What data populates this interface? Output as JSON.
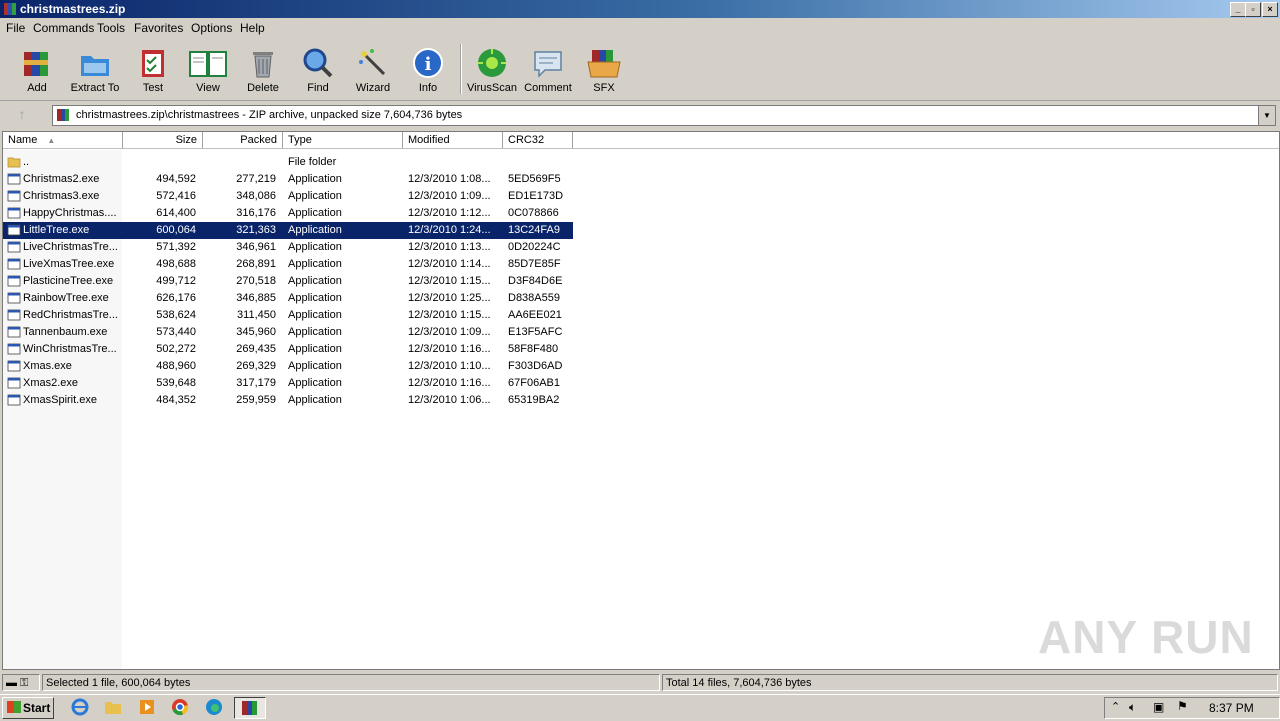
{
  "window": {
    "title": "christmastrees.zip"
  },
  "menu": [
    "File",
    "Commands",
    "Tools",
    "Favorites",
    "Options",
    "Help"
  ],
  "toolbar": [
    "Add",
    "Extract To",
    "Test",
    "View",
    "Delete",
    "Find",
    "Wizard",
    "Info",
    "VirusScan",
    "Comment",
    "SFX"
  ],
  "address": {
    "path": "christmastrees.zip\\christmastrees - ZIP archive, unpacked size 7,604,736 bytes"
  },
  "columns": [
    "Name",
    "Size",
    "Packed",
    "Type",
    "Modified",
    "CRC32"
  ],
  "files": [
    {
      "name": "..",
      "size": "",
      "packed": "",
      "type": "File folder",
      "modified": "",
      "crc": ""
    },
    {
      "name": "Christmas2.exe",
      "size": "494,592",
      "packed": "277,219",
      "type": "Application",
      "modified": "12/3/2010 1:08...",
      "crc": "5ED569F5"
    },
    {
      "name": "Christmas3.exe",
      "size": "572,416",
      "packed": "348,086",
      "type": "Application",
      "modified": "12/3/2010 1:09...",
      "crc": "ED1E173D"
    },
    {
      "name": "HappyChristmas....",
      "size": "614,400",
      "packed": "316,176",
      "type": "Application",
      "modified": "12/3/2010 1:12...",
      "crc": "0C078866"
    },
    {
      "name": "LittleTree.exe",
      "size": "600,064",
      "packed": "321,363",
      "type": "Application",
      "modified": "12/3/2010 1:24...",
      "crc": "13C24FA9"
    },
    {
      "name": "LiveChristmasTre...",
      "size": "571,392",
      "packed": "346,961",
      "type": "Application",
      "modified": "12/3/2010 1:13...",
      "crc": "0D20224C"
    },
    {
      "name": "LiveXmasTree.exe",
      "size": "498,688",
      "packed": "268,891",
      "type": "Application",
      "modified": "12/3/2010 1:14...",
      "crc": "85D7E85F"
    },
    {
      "name": "PlasticineTree.exe",
      "size": "499,712",
      "packed": "270,518",
      "type": "Application",
      "modified": "12/3/2010 1:15...",
      "crc": "D3F84D6E"
    },
    {
      "name": "RainbowTree.exe",
      "size": "626,176",
      "packed": "346,885",
      "type": "Application",
      "modified": "12/3/2010 1:25...",
      "crc": "D838A559"
    },
    {
      "name": "RedChristmasTre...",
      "size": "538,624",
      "packed": "311,450",
      "type": "Application",
      "modified": "12/3/2010 1:15...",
      "crc": "AA6EE021"
    },
    {
      "name": "Tannenbaum.exe",
      "size": "573,440",
      "packed": "345,960",
      "type": "Application",
      "modified": "12/3/2010 1:09...",
      "crc": "E13F5AFC"
    },
    {
      "name": "WinChristmasTre...",
      "size": "502,272",
      "packed": "269,435",
      "type": "Application",
      "modified": "12/3/2010 1:16...",
      "crc": "58F8F480"
    },
    {
      "name": "Xmas.exe",
      "size": "488,960",
      "packed": "269,329",
      "type": "Application",
      "modified": "12/3/2010 1:10...",
      "crc": "F303D6AD"
    },
    {
      "name": "Xmas2.exe",
      "size": "539,648",
      "packed": "317,179",
      "type": "Application",
      "modified": "12/3/2010 1:16...",
      "crc": "67F06AB1"
    },
    {
      "name": "XmasSpirit.exe",
      "size": "484,352",
      "packed": "259,959",
      "type": "Application",
      "modified": "12/3/2010 1:06...",
      "crc": "65319BA2"
    }
  ],
  "selected_index": 4,
  "status": {
    "left": "Selected 1 file, 600,064 bytes",
    "right": "Total 14 files, 7,604,736 bytes"
  },
  "taskbar": {
    "start": "Start",
    "clock": "8:37 PM"
  },
  "watermark": "ANY RUN",
  "colors": {
    "selection": "#0a246a",
    "titlebar": "#0a246a",
    "face": "#d4d0c8"
  }
}
